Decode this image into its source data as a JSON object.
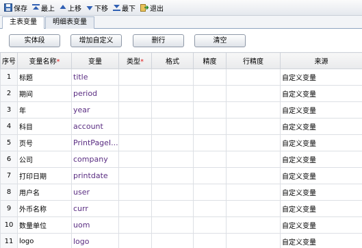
{
  "toolbar": {
    "save": "保存",
    "top": "最上",
    "up": "上移",
    "down": "下移",
    "bottom": "最下",
    "exit": "退出"
  },
  "tabs": [
    "主表变量",
    "明细表变量"
  ],
  "actions": [
    "实体段",
    "增加自定义",
    "删行",
    "清空"
  ],
  "columns": [
    "序号",
    "变量名称",
    "变量",
    "类型",
    "格式",
    "精度",
    "行精度",
    "来源"
  ],
  "rows": [
    {
      "no": "1",
      "name": "标题",
      "var": "title",
      "source": "自定义变量"
    },
    {
      "no": "2",
      "name": "期间",
      "var": "period",
      "source": "自定义变量"
    },
    {
      "no": "3",
      "name": "年",
      "var": "year",
      "source": "自定义变量"
    },
    {
      "no": "4",
      "name": "科目",
      "var": "account",
      "source": "自定义变量"
    },
    {
      "no": "5",
      "name": "页号",
      "var": "PrintPageI...",
      "source": "自定义变量"
    },
    {
      "no": "6",
      "name": "公司",
      "var": "company",
      "source": "自定义变量"
    },
    {
      "no": "7",
      "name": "打印日期",
      "var": "printdate",
      "source": "自定义变量"
    },
    {
      "no": "8",
      "name": "用户名",
      "var": "user",
      "source": "自定义变量"
    },
    {
      "no": "9",
      "name": "外币名称",
      "var": "curr",
      "source": "自定义变量"
    },
    {
      "no": "10",
      "name": "数量单位",
      "var": "uom",
      "source": "自定义变量"
    },
    {
      "no": "11",
      "name": "logo",
      "var": "logo",
      "source": "自定义变量"
    }
  ]
}
